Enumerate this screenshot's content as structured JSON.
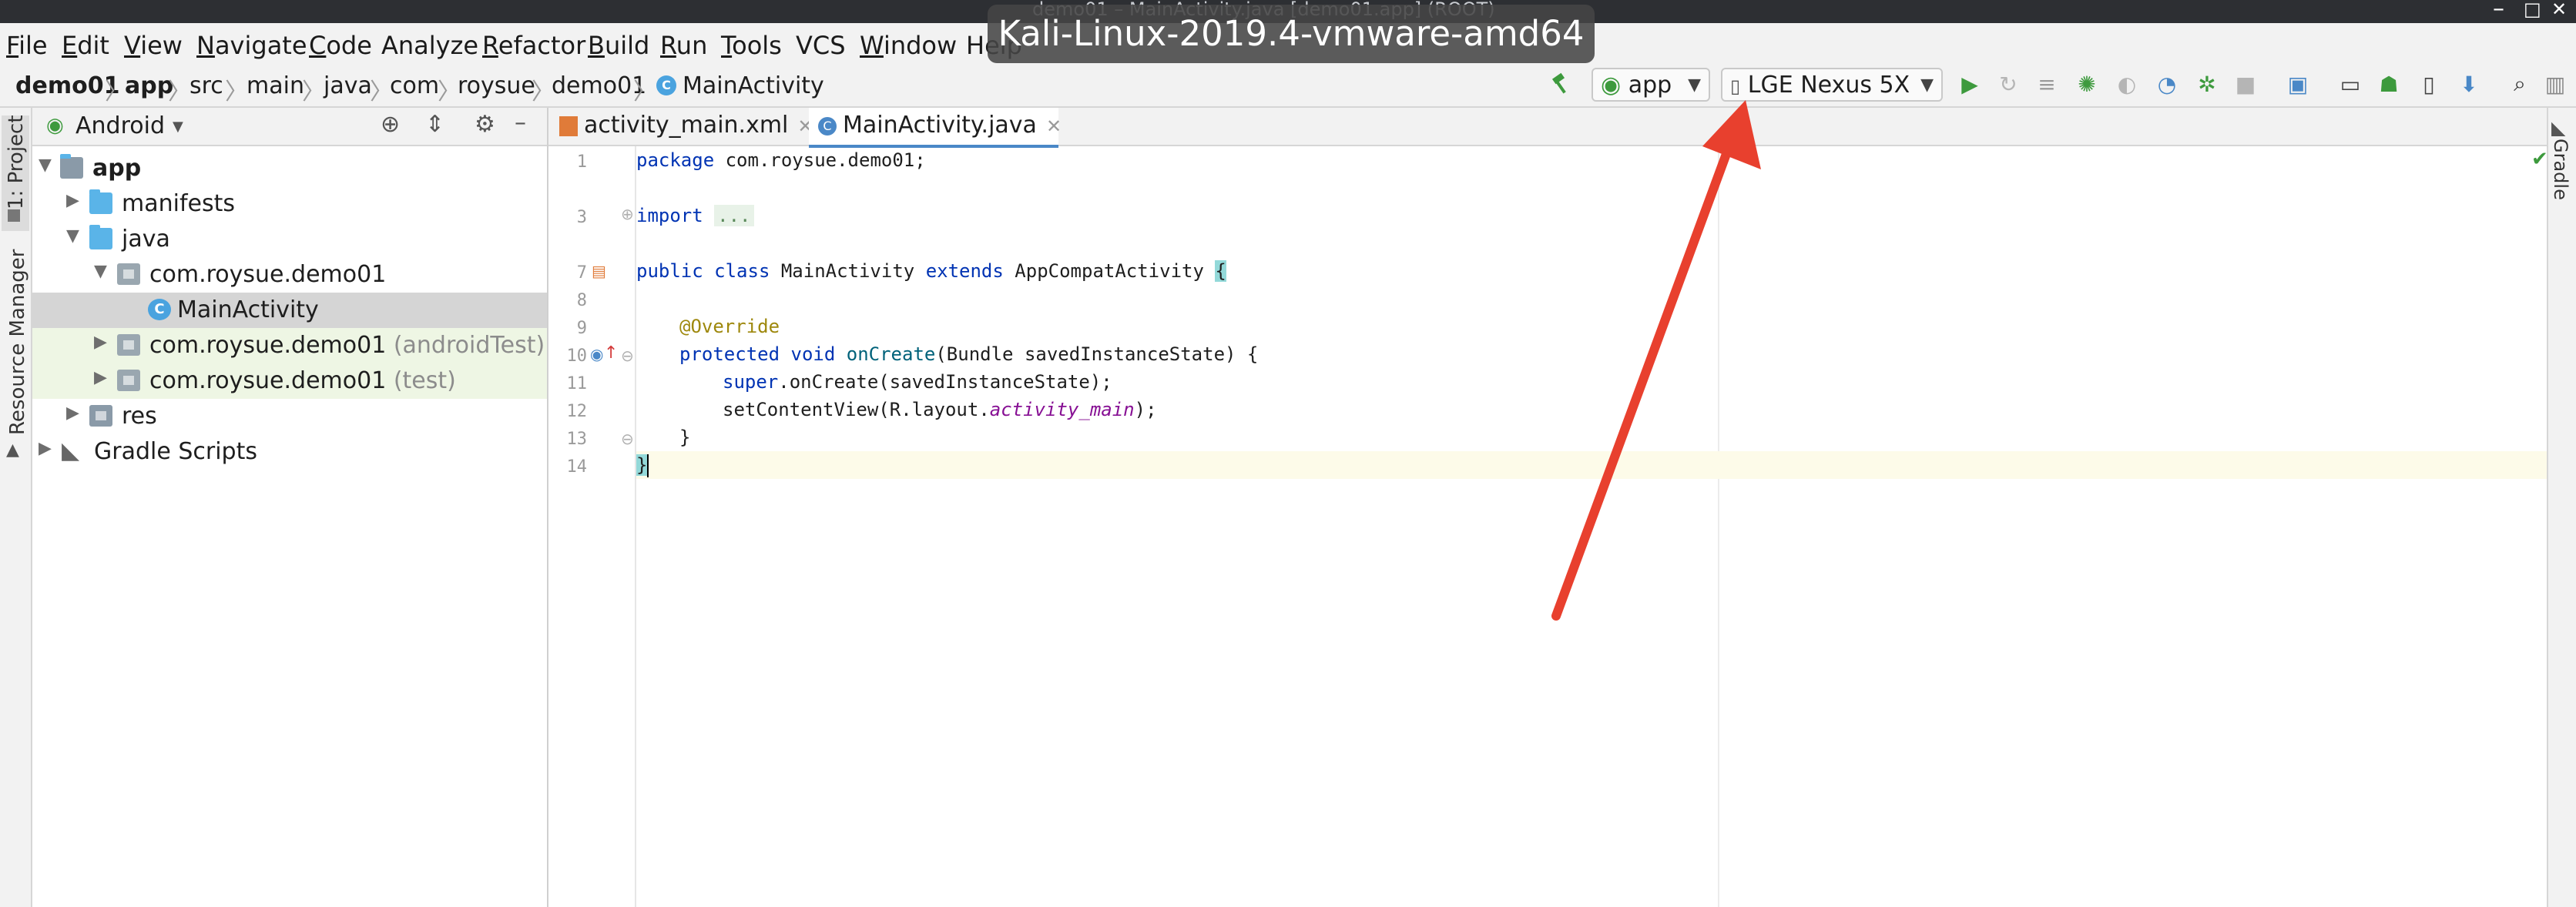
{
  "window": {
    "title": "demo01 – MainActivity.java [demo01.app] (ROOT)",
    "controls": [
      "–",
      "□",
      "✕"
    ]
  },
  "vm_overlay": "Kali-Linux-2019.4-vmware-amd64",
  "menu": [
    {
      "u": "F",
      "rest": "ile"
    },
    {
      "u": "E",
      "rest": "dit"
    },
    {
      "u": "V",
      "rest": "iew"
    },
    {
      "u": "N",
      "rest": "avigate"
    },
    {
      "u": "C",
      "rest": "ode"
    },
    {
      "u": "",
      "rest": "Analyze"
    },
    {
      "u": "R",
      "rest": "efactor"
    },
    {
      "u": "B",
      "rest": "uild"
    },
    {
      "u": "R",
      "rest": "un"
    },
    {
      "u": "T",
      "rest": "ools"
    },
    {
      "u": "",
      "rest": "VCS"
    },
    {
      "u": "W",
      "rest": "indow"
    },
    {
      "u": "",
      "rest": "Help"
    }
  ],
  "breadcrumb": [
    "demo01",
    "app",
    "src",
    "main",
    "java",
    "com",
    "roysue",
    "demo01",
    "MainActivity"
  ],
  "toolbar": {
    "run_config": "app",
    "device": "LGE Nexus 5X"
  },
  "left_stripe": {
    "project_tab": "1: Project",
    "resource_tab": "Resource Manager"
  },
  "right_stripe": {
    "gradle_tab": "Gradle"
  },
  "project_panel": {
    "view_mode": "Android",
    "tree": [
      {
        "label": "app",
        "suffix": ""
      },
      {
        "label": "manifests",
        "suffix": ""
      },
      {
        "label": "java",
        "suffix": ""
      },
      {
        "label": "com.roysue.demo01",
        "suffix": ""
      },
      {
        "label": "MainActivity",
        "suffix": ""
      },
      {
        "label": "com.roysue.demo01",
        "suffix": "(androidTest)"
      },
      {
        "label": "com.roysue.demo01",
        "suffix": "(test)"
      },
      {
        "label": "res",
        "suffix": ""
      },
      {
        "label": "Gradle Scripts",
        "suffix": ""
      }
    ]
  },
  "editor": {
    "tabs": [
      "activity_main.xml",
      "MainActivity.java"
    ],
    "active_tab": "MainActivity.java",
    "line_numbers": [
      "1",
      "3",
      "7",
      "8",
      "9",
      "10",
      "11",
      "12",
      "13",
      "14"
    ],
    "code": {
      "l1_kw": "package",
      "l1_rest": " com.roysue.demo01;",
      "l3_kw": "import",
      "l3_fold": "...",
      "l7_kw1": "public class",
      "l7_name": " MainActivity ",
      "l7_kw2": "extends",
      "l7_rest": " AppCompatActivity ",
      "l7_brace": "{",
      "l9_ann": "@Override",
      "l10_kw": "protected void",
      "l10_fn": "onCreate",
      "l10_rest": "(Bundle savedInstanceState) {",
      "l11_kw": "super",
      "l11_rest": ".onCreate(savedInstanceState);",
      "l12_pre": "setContentView(R.layout.",
      "l12_it": "activity_main",
      "l12_post": ");",
      "l13": "}",
      "l14": "}"
    }
  },
  "colors": {
    "accent_blue": "#4a88c7",
    "arrow_red": "#e8402e",
    "run_green": "#3d9a3d"
  }
}
